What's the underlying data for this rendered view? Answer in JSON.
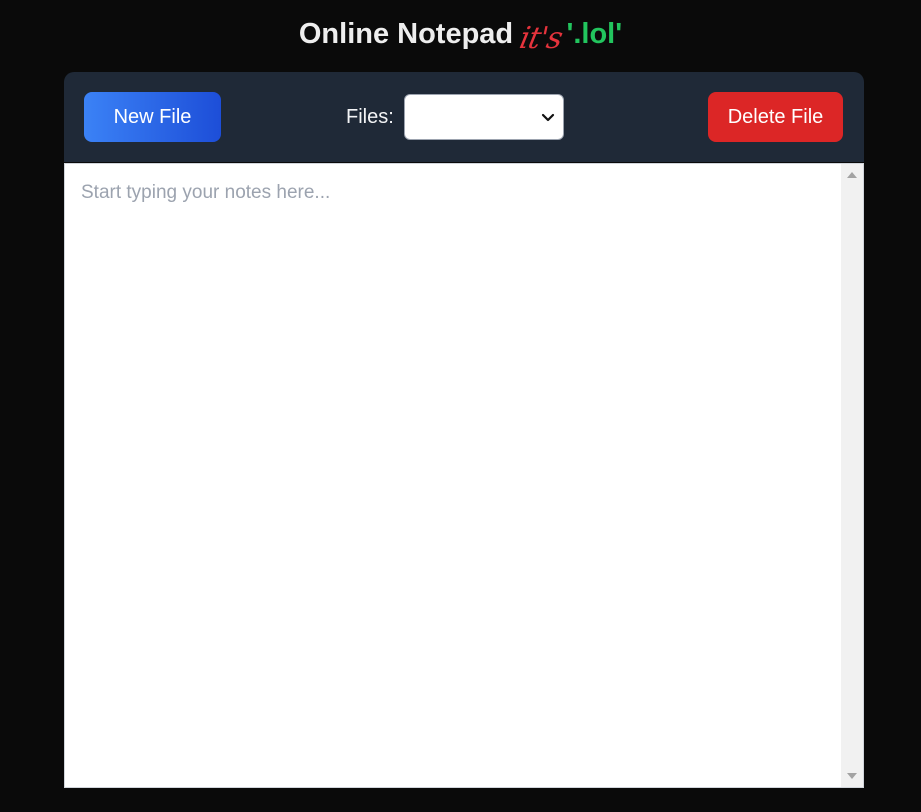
{
  "header": {
    "title_main": "Online Notepad",
    "title_script": "it's",
    "title_accent": "'.lol'"
  },
  "toolbar": {
    "new_file_label": "New File",
    "files_label": "Files:",
    "files_selected": "",
    "delete_file_label": "Delete File"
  },
  "editor": {
    "placeholder": "Start typing your notes here...",
    "value": ""
  },
  "colors": {
    "background": "#0a0a0a",
    "toolbar": "#1f2937",
    "new_button": "#3b82f6",
    "delete_button": "#dc2626",
    "accent_green": "#22c55e",
    "accent_red": "#e5333c"
  },
  "icons": {
    "select_chevron": "chevron-down-icon",
    "scroll_up": "scroll-up-arrow",
    "scroll_down": "scroll-down-arrow"
  }
}
